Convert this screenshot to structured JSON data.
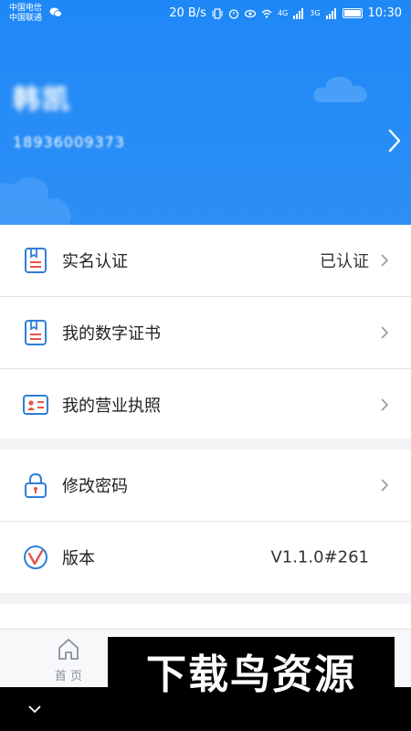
{
  "status_bar": {
    "carrier_1": "中国电信",
    "carrier_2": "中国联通",
    "speed": "20 B/s",
    "network_4g": "4G",
    "network_3g": "3G",
    "time": "10:30"
  },
  "profile": {
    "name": "韩凯",
    "phone": "18936009373"
  },
  "menu": [
    {
      "label": "实名认证",
      "value": "已认证",
      "icon": "id-card-icon"
    },
    {
      "label": "我的数字证书",
      "value": "",
      "icon": "certificate-icon"
    },
    {
      "label": "我的营业执照",
      "value": "",
      "icon": "license-icon"
    }
  ],
  "menu2": [
    {
      "label": "修改密码",
      "value": "",
      "icon": "lock-icon"
    },
    {
      "label": "版本",
      "value": "V1.1.0#261",
      "icon": "version-icon"
    }
  ],
  "tabbar": {
    "home_label": "首 页"
  },
  "watermark": "下载鸟资源",
  "colors": {
    "accent": "#1e88f7",
    "icon_blue": "#2f7fd8",
    "icon_red": "#e8524a"
  }
}
